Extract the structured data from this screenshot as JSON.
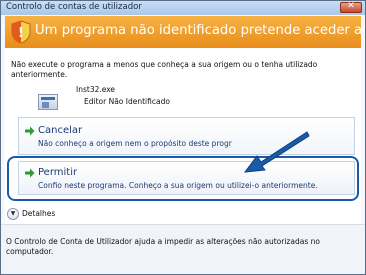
{
  "window": {
    "title": "Controlo de contas de utilizador",
    "close_label": "✕"
  },
  "banner": {
    "text": "Um programa não identificado pretende aceder ao computador",
    "color": "#f0a030"
  },
  "warning": {
    "text": "Não execute o programa a menos que conheça a sua origem ou o tenha utilizado anteriormente."
  },
  "program": {
    "icon": "application-window-icon",
    "name": "Inst32.exe",
    "publisher": "Editor Não Identificado"
  },
  "options": {
    "cancel": {
      "title": "Cancelar",
      "description": "Não conheço a origem nem o propósito deste progr"
    },
    "allow": {
      "title": "Permitir",
      "description": "Confio neste programa. Conheço a sua origem ou utilizei-o anteriormente."
    }
  },
  "details": {
    "label": "Detalhes",
    "icon": "chevron-down-icon"
  },
  "footer": {
    "text": "O Controlo de Conta de Utilizador ajuda a impedir as alterações não autorizadas no computador."
  },
  "annotation": {
    "highlight_color": "#1a5aa6",
    "arrow_color": "#1a5aa6"
  }
}
